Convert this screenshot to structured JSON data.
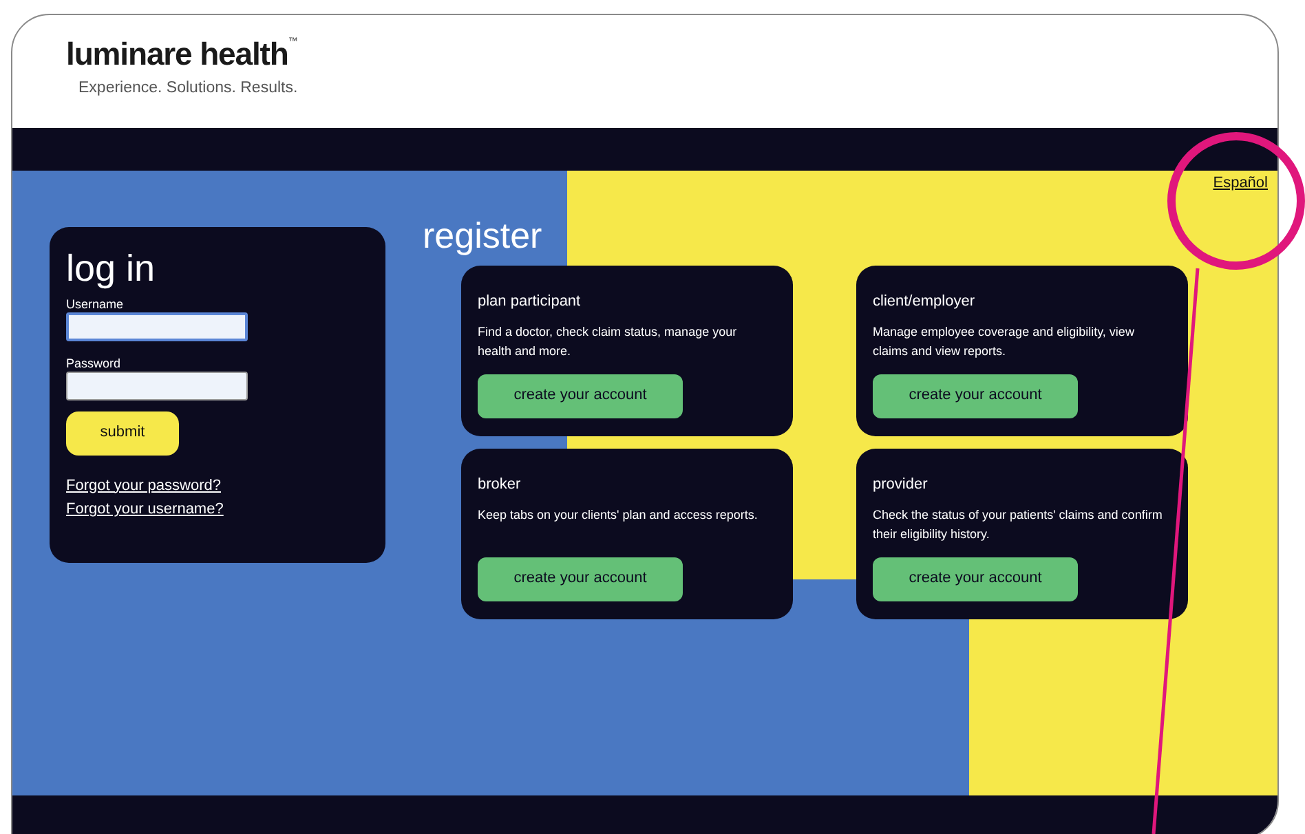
{
  "header": {
    "logo": "luminare health",
    "trademark": "™",
    "tagline": "Experience. Solutions. Results."
  },
  "language_link": "Español",
  "login": {
    "title": "log in",
    "fields": [
      {
        "label": "Username",
        "focused": true
      },
      {
        "label": "Password",
        "focused": false
      }
    ],
    "submit": "submit",
    "links": [
      "Forgot your password?",
      "Forgot your username?"
    ]
  },
  "register": {
    "title": "register",
    "cards": [
      {
        "title": "plan participant",
        "description": "Find a doctor, check claim status, manage your health and more.",
        "button": "create your account"
      },
      {
        "title": "client/employer",
        "description": "Manage employee coverage and eligibility, view claims and view reports.",
        "button": "create your account"
      },
      {
        "title": "broker",
        "description": "Keep tabs on your clients' plan and access reports.",
        "button": "create your account"
      },
      {
        "title": "provider",
        "description": "Check the status of your patients' claims and confirm their eligibility history.",
        "button": "create your account"
      }
    ]
  }
}
